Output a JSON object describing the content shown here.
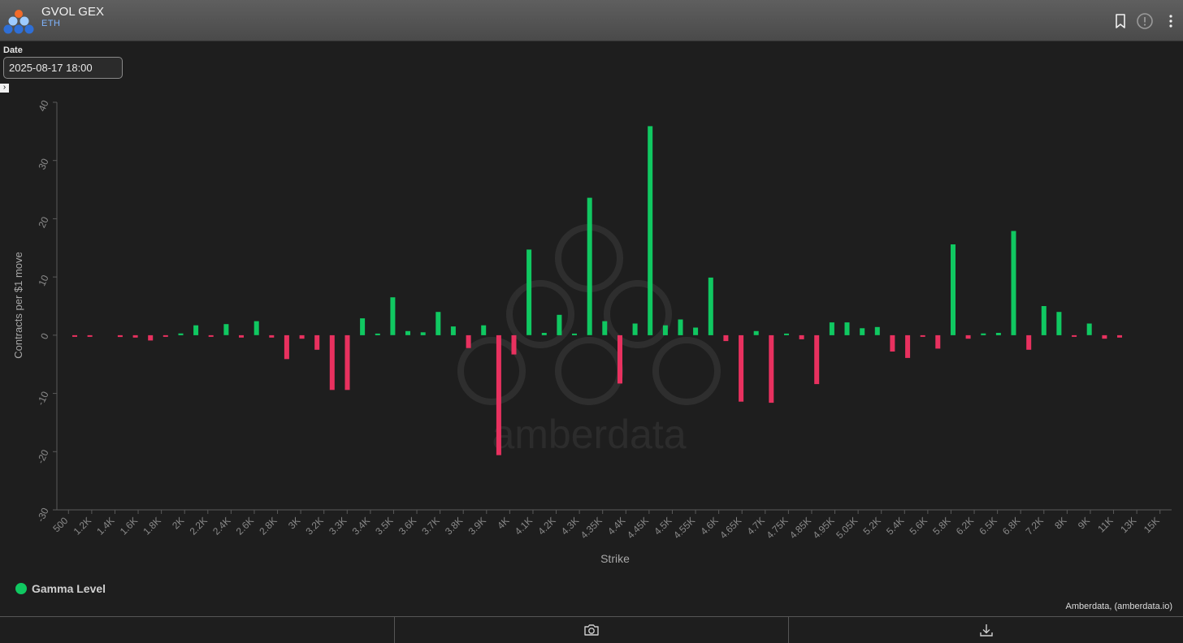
{
  "header": {
    "title": "GVOL GEX",
    "subtitle": "ETH",
    "icons": [
      "bookmark-icon",
      "info-icon",
      "more-vertical-icon"
    ]
  },
  "date_filter": {
    "label": "Date",
    "value": "2025-08-17 18:00"
  },
  "colors": {
    "positive": "#10c861",
    "negative": "#e8315f",
    "background": "#1e1e1e",
    "header": "#555555"
  },
  "chart_data": {
    "type": "bar",
    "title": "",
    "xlabel": "Strike",
    "ylabel": "Contracts per $1 move",
    "ylim": [
      -30,
      40
    ],
    "yticks": [
      40,
      30,
      20,
      10,
      0,
      -10,
      -20,
      -30
    ],
    "categories": [
      "500",
      "1.2K",
      "1.4K",
      "1.6K",
      "1.8K",
      "2K",
      "2.2K",
      "2.4K",
      "2.6K",
      "2.8K",
      "3K",
      "3.2K",
      "3.3K",
      "3.4K",
      "3.5K",
      "3.6K",
      "3.7K",
      "3.8K",
      "3.9K",
      "4K",
      "4.1K",
      "4.2K",
      "4.3K",
      "4.35K",
      "4.4K",
      "4.45K",
      "4.5K",
      "4.55K",
      "4.6K",
      "4.65K",
      "4.7K",
      "4.75K",
      "4.85K",
      "4.95K",
      "5.05K",
      "5.2K",
      "5.4K",
      "5.6K",
      "5.8K",
      "6.2K",
      "6.5K",
      "6.8K",
      "7.2K",
      "8K",
      "9K",
      "11K",
      "13K",
      "15K"
    ],
    "values": [
      -0.2,
      -0.2,
      0,
      -0.3,
      -0.4,
      -0.9,
      -0.2,
      0.3,
      1.7,
      -0.2,
      1.9,
      -0.4,
      2.4,
      -0.4,
      -4.1,
      -0.6,
      -2.5,
      -9.4,
      -9.4,
      2.9,
      0.2,
      6.5,
      0.7,
      0.5,
      4.0,
      1.5,
      -2.2,
      1.7,
      -20.6,
      -3.3,
      14.7,
      0.4,
      3.5,
      0.2,
      23.6,
      2.4,
      -8.3,
      2.0,
      35.9,
      1.7,
      2.7,
      1.3,
      9.9,
      -1.0,
      -11.4,
      0.7,
      -11.6,
      0.2,
      -0.7,
      -8.4,
      2.2,
      2.2,
      1.2,
      1.4,
      -2.8,
      -3.9,
      -0.2,
      -2.3,
      15.6,
      -0.6,
      0.3,
      0.4,
      17.9,
      -2.5,
      5.0,
      4.0,
      -0.2,
      2.0,
      -0.6,
      -0.4
    ],
    "series_name": "Gamma Level",
    "legend_position": "bottom-left",
    "grid": false
  },
  "legend": {
    "label": "Gamma Level"
  },
  "credit": "Amberdata, (amberdata.io)",
  "watermark": "amberdata",
  "footer": {
    "icons": [
      "camera-icon",
      "download-icon"
    ]
  }
}
